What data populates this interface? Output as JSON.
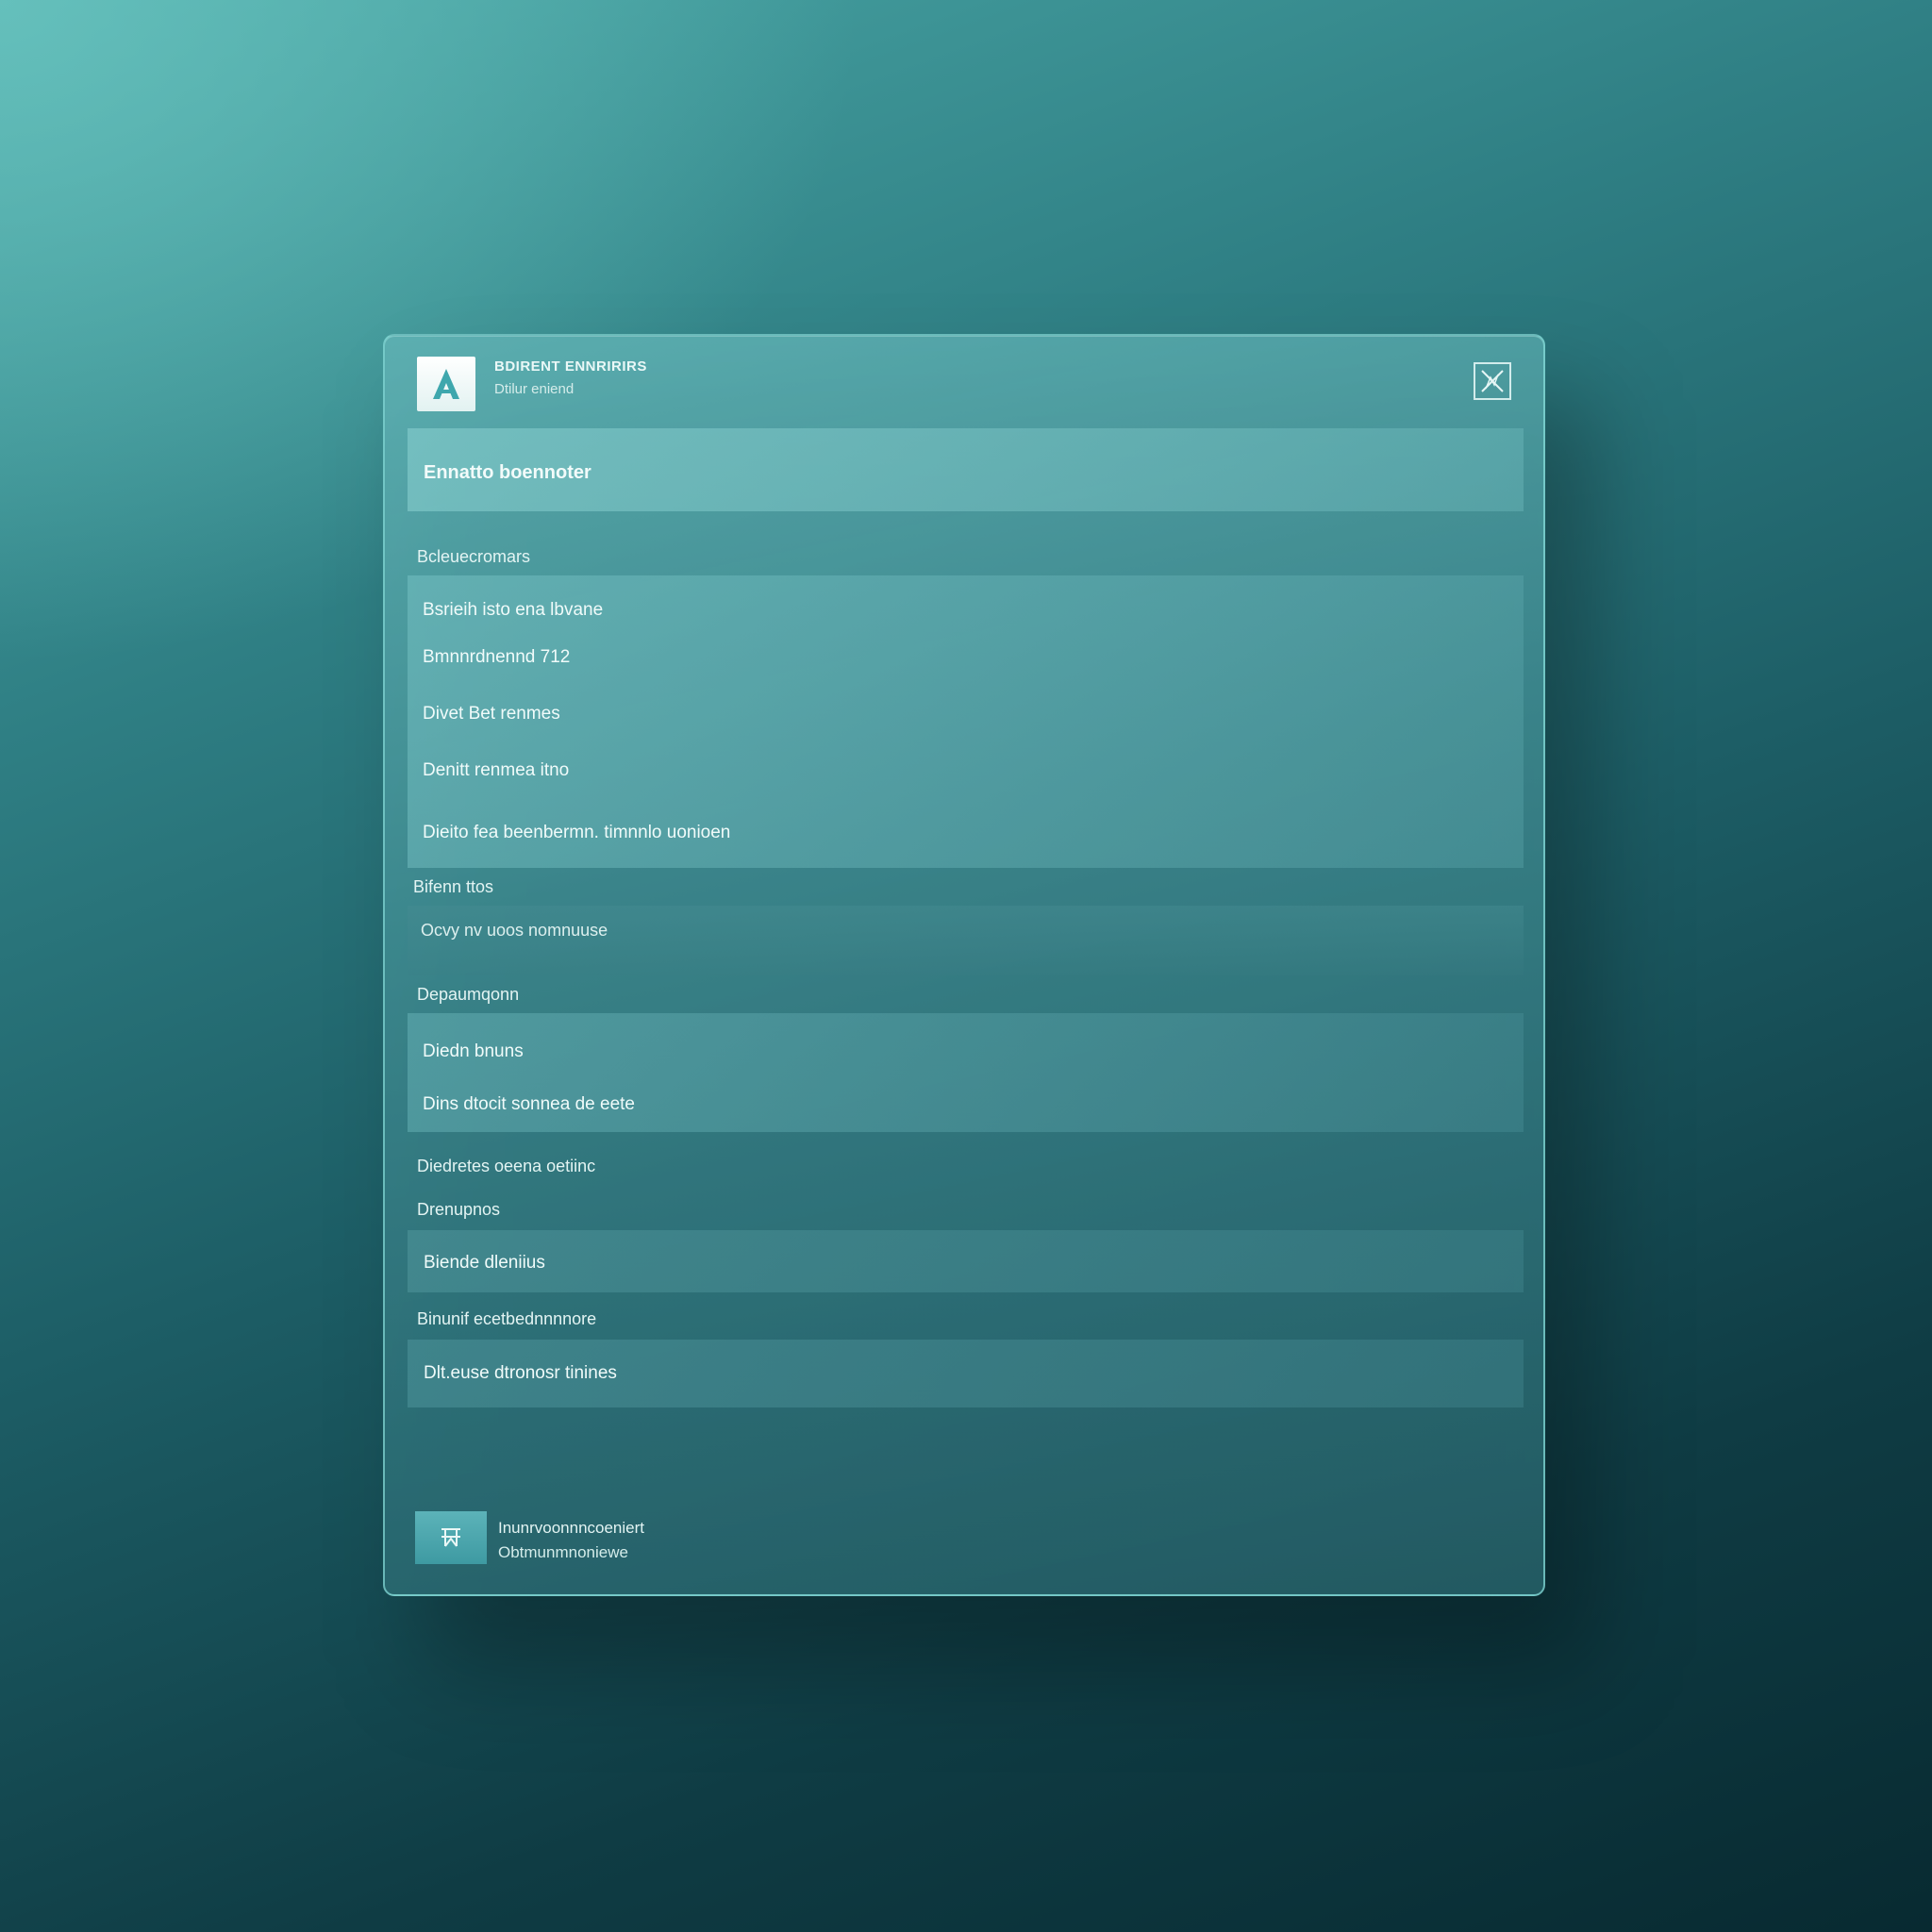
{
  "header": {
    "title": "BDIRENT ENNRIRIRS",
    "subtitle": "Dtilur eniend",
    "logo_letter": "A"
  },
  "primary_field": {
    "label": "Ennatto boennoter"
  },
  "section_1": {
    "label": "Bcleuecromars",
    "items": [
      "Bsrieih isto ena lbvane",
      "Bmnnrdnennd 712",
      "Divet Bet renmes",
      "Denitt renmea itno",
      "Dieito fea beenbermn. timnnlo uonioen"
    ]
  },
  "section_2": {
    "label": "Bifenn ttos",
    "info": "Ocvy nv uoos nomnuuse"
  },
  "section_3": {
    "label": "Depaumqonn",
    "items": [
      "Diedn bnuns",
      "Dins dtocit sonnea de eete"
    ]
  },
  "section_4": {
    "label": "Diedretes oeena oetiinc"
  },
  "section_5": {
    "label": "Drenupnos",
    "field": "Biende dleniius"
  },
  "section_6": {
    "label": "Binunif ecetbednnnnore",
    "field": "Dlt.euse dtronosr tinines"
  },
  "footer": {
    "line1": "Inunrvoonnncoeniert",
    "line2": "Obtmunmnoniewe"
  }
}
